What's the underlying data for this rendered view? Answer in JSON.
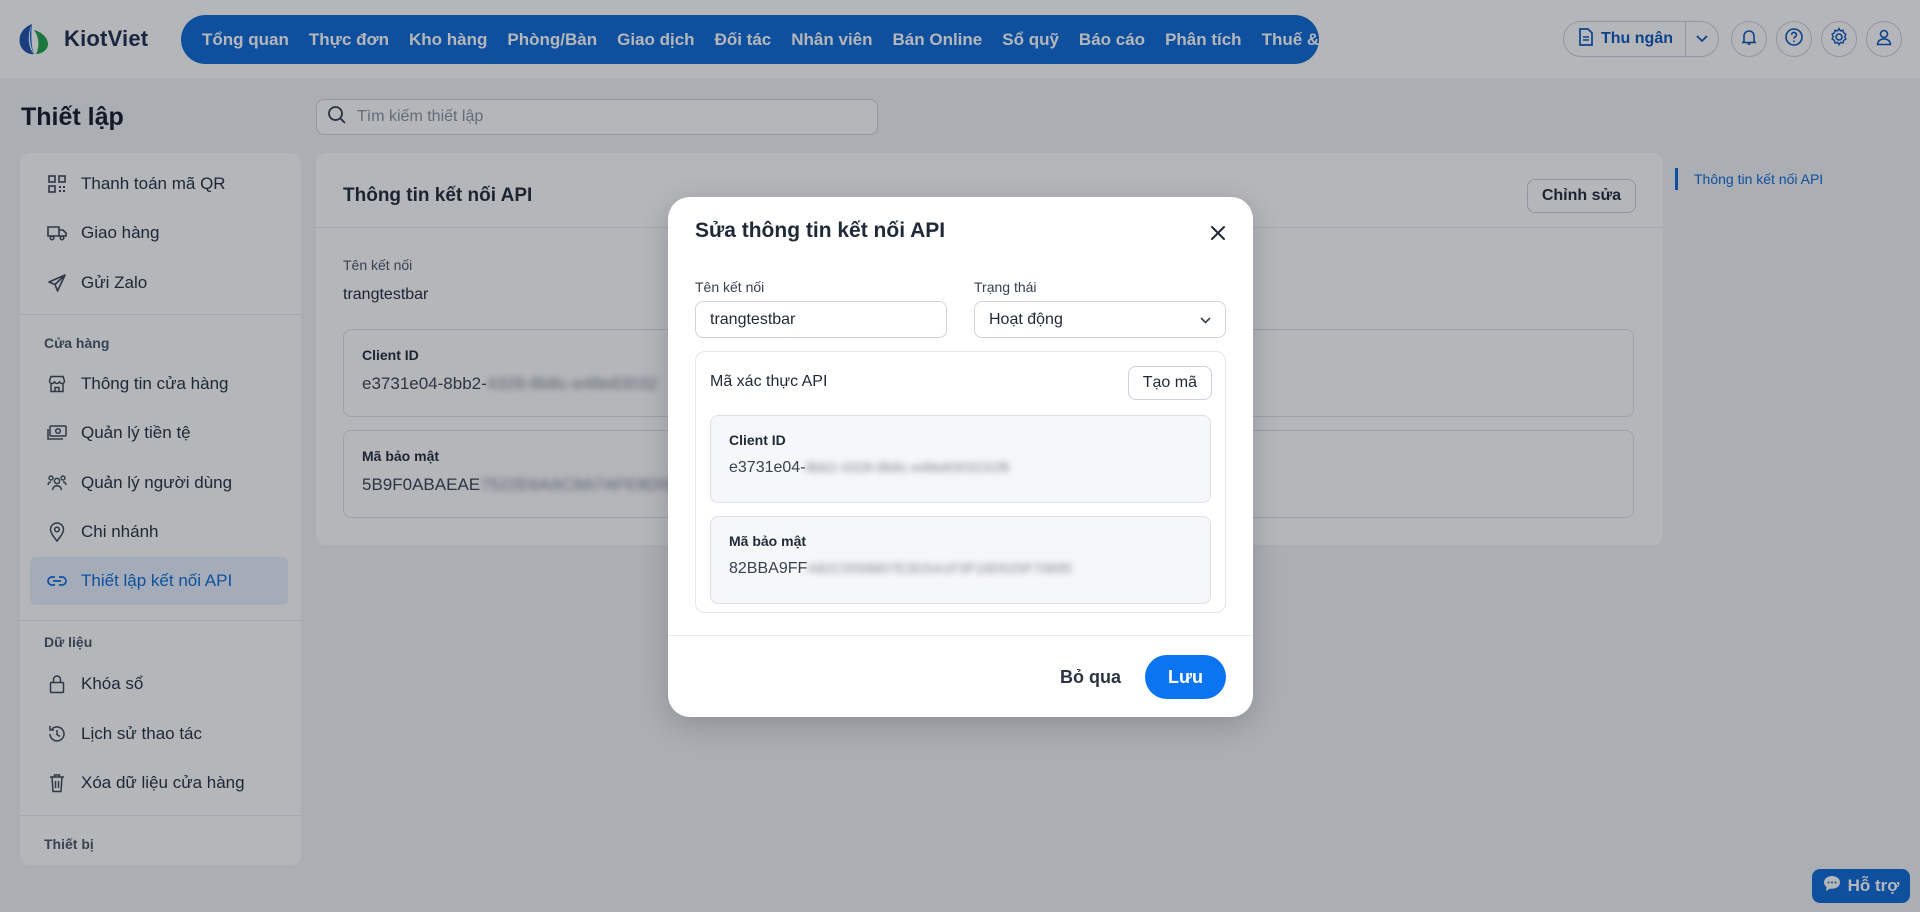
{
  "brand": {
    "name": "KiotViet",
    "primary_color": "#0b69d6"
  },
  "nav": {
    "items": [
      {
        "label": "Tổng quan"
      },
      {
        "label": "Thực đơn"
      },
      {
        "label": "Kho hàng"
      },
      {
        "label": "Phòng/Bàn"
      },
      {
        "label": "Giao dịch"
      },
      {
        "label": "Đối tác"
      },
      {
        "label": "Nhân viên"
      },
      {
        "label": "Bán Online"
      },
      {
        "label": "Sổ quỹ"
      },
      {
        "label": "Báo cáo"
      },
      {
        "label": "Phân tích"
      },
      {
        "label": "Thuế & Kế toán"
      }
    ],
    "cashier_label": "Thu ngân",
    "icons": [
      "bell-icon",
      "help-circle-icon",
      "gear-icon",
      "user-icon"
    ]
  },
  "page": {
    "title": "Thiết lập",
    "search_placeholder": "Tìm kiếm thiết lập"
  },
  "sidebar": {
    "items_top": [
      {
        "label": "Thanh toán mã QR",
        "icon": "qr-icon"
      },
      {
        "label": "Giao hàng",
        "icon": "truck-icon"
      },
      {
        "label": "Gửi Zalo",
        "icon": "send-icon"
      }
    ],
    "section_store": "Cửa hàng",
    "items_store": [
      {
        "label": "Thông tin cửa hàng",
        "icon": "store-icon"
      },
      {
        "label": "Quản lý tiền tệ",
        "icon": "money-icon"
      },
      {
        "label": "Quản lý người dùng",
        "icon": "users-icon"
      },
      {
        "label": "Chi nhánh",
        "icon": "location-icon"
      },
      {
        "label": "Thiết lập kết nối API",
        "icon": "link-icon",
        "active": true
      }
    ],
    "section_data": "Dữ liệu",
    "items_data": [
      {
        "label": "Khóa sổ",
        "icon": "lock-icon"
      },
      {
        "label": "Lịch sử thao tác",
        "icon": "history-icon"
      },
      {
        "label": "Xóa dữ liệu cửa hàng",
        "icon": "trash-icon"
      }
    ],
    "section_device": "Thiết bị"
  },
  "card": {
    "title": "Thông tin kết nối API",
    "edit_label": "Chỉnh sửa",
    "name_label": "Tên kết nối",
    "name_value": "trangtestbar",
    "client_id_label": "Client ID",
    "client_id_visible": "e3731e04-8bb2-",
    "client_id_hidden": "4328-8b8c-e48e83032",
    "secret_label": "Mã bảo mật",
    "secret_visible": "5B9F0ABAEAE",
    "secret_hidden": "7522E6AAC8A7AFE8D0DA"
  },
  "toc": {
    "link": "Thông tin kết nối API"
  },
  "modal": {
    "title": "Sửa thông tin kết nối API",
    "name_label": "Tên kết nối",
    "name_value": "trangtestbar",
    "status_label": "Trạng thái",
    "status_value": "Hoạt động",
    "auth_title": "Mã xác thực API",
    "generate_label": "Tạo mã",
    "client_id_label": "Client ID",
    "client_id_visible": "e3731e04-",
    "client_id_hidden": "8bb2-4328-8b8c-e48e8303231f6",
    "secret_label": "Mã bảo mật",
    "secret_visible": "82BBA9FF",
    "secret_hidden": "A82C5558807E3DSA1F3F18D025F70695",
    "cancel_label": "Bỏ qua",
    "save_label": "Lưu"
  },
  "help": {
    "label": "Hỗ trợ"
  }
}
